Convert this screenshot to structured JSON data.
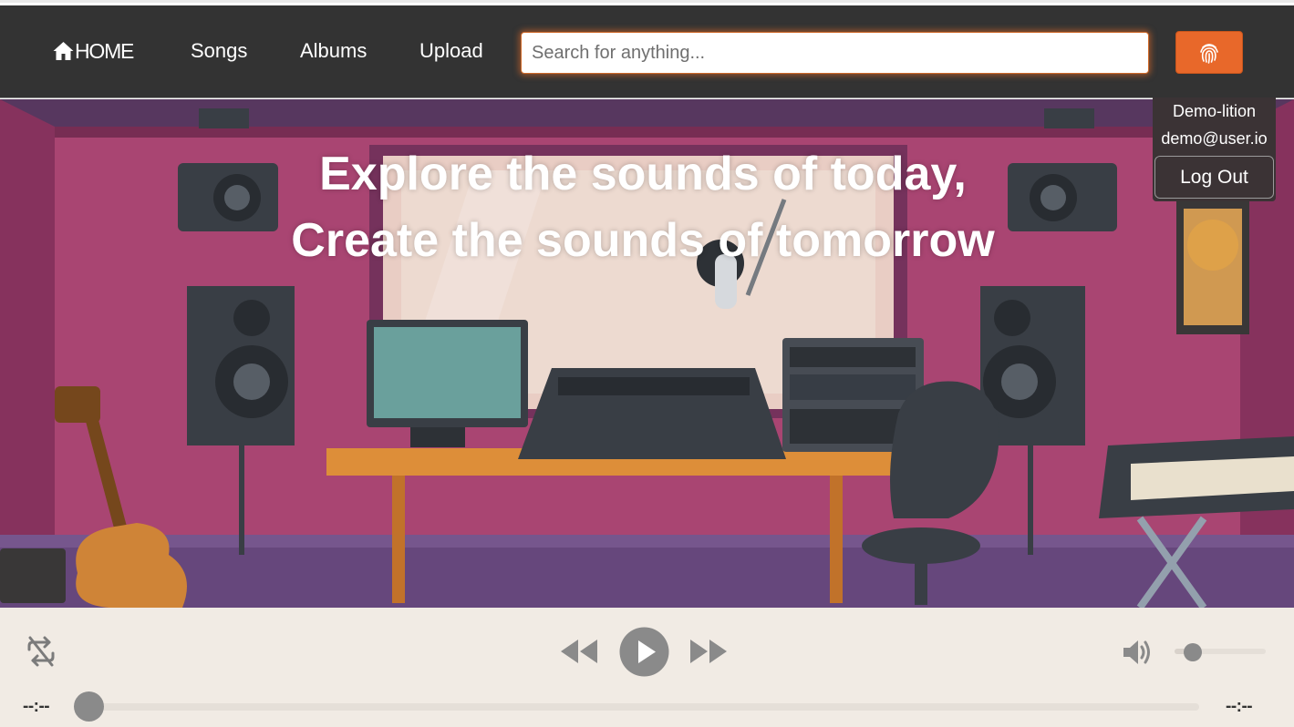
{
  "nav": {
    "home_label": "HOME",
    "links": [
      "Songs",
      "Albums",
      "Upload"
    ],
    "search_placeholder": "Search for anything...",
    "icons": {
      "home": "home-icon",
      "login": "fingerprint-icon"
    },
    "accent": "#e8682a"
  },
  "hero": {
    "line1": "Explore the sounds of today,",
    "line2": "Create the sounds of tomorrow"
  },
  "user": {
    "name": "Demo-lition",
    "email": "demo@user.io",
    "logout_label": "Log Out"
  },
  "player": {
    "current_time": "--:--",
    "duration": "--:--",
    "progress": 0,
    "volume": 0.2,
    "icons": [
      "repeat-off-icon",
      "rewind-icon",
      "play-icon",
      "fast-forward-icon",
      "volume-icon"
    ],
    "background": "#f1ebe4"
  }
}
